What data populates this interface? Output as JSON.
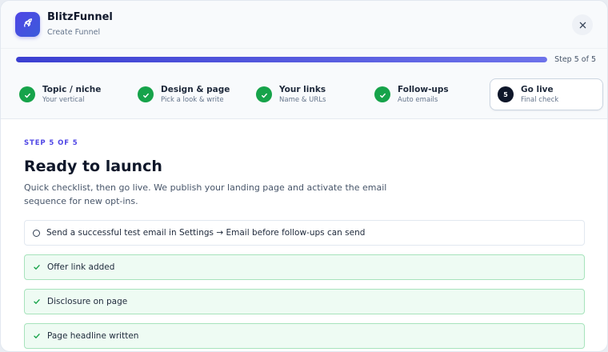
{
  "header": {
    "app_name": "BlitzFunnel",
    "subtitle": "Create Funnel",
    "logo_icon": "rocket-icon",
    "close_icon": "close-icon"
  },
  "progress": {
    "fraction": 1.0,
    "label": "Step 5 of 5"
  },
  "steps": [
    {
      "title": "Topic / niche",
      "subtitle": "Your vertical",
      "status": "done"
    },
    {
      "title": "Design & page",
      "subtitle": "Pick a look & write",
      "status": "done"
    },
    {
      "title": "Your links",
      "subtitle": "Name & URLs",
      "status": "done"
    },
    {
      "title": "Follow-ups",
      "subtitle": "Auto emails",
      "status": "done"
    },
    {
      "title": "Go live",
      "subtitle": "Final check",
      "status": "current",
      "number": "5"
    }
  ],
  "content": {
    "eyebrow": "STEP 5 OF 5",
    "title": "Ready to launch",
    "description": "Quick checklist, then go live. We publish your landing page and activate the email sequence for new opt-ins."
  },
  "checklist": [
    {
      "text": "Send a successful test email in Settings → Email before follow-ups can send",
      "status": "pending"
    },
    {
      "text": "Offer link added",
      "status": "done"
    },
    {
      "text": "Disclosure on page",
      "status": "done"
    },
    {
      "text": "Page headline written",
      "status": "done"
    }
  ],
  "colors": {
    "accent": "#4f46e5",
    "success": "#16a34a",
    "success_bg": "#eefbf3"
  }
}
